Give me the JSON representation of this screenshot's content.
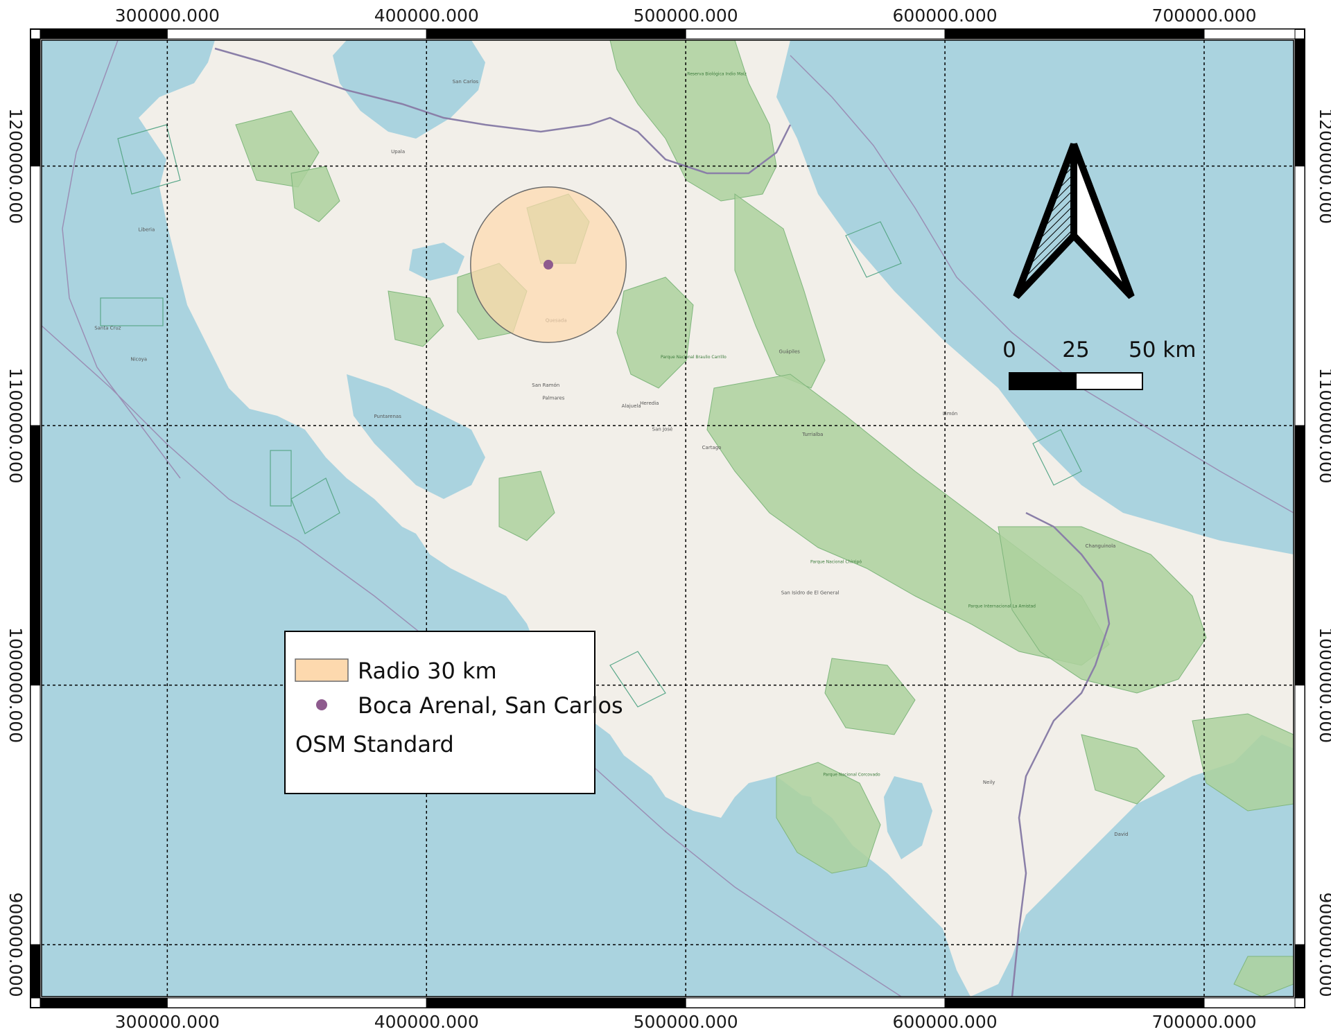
{
  "map": {
    "basemap": "OSM Standard",
    "colors": {
      "water": "#aad3df",
      "land": "#f2efe9",
      "forest": "#add19e",
      "park_border": "#7fb67c",
      "buffer_fill": "#fdd9ae",
      "buffer_stroke": "#6b6b6b",
      "point": "#8e5b8e",
      "border_line": "#9a8fb5"
    },
    "x_ticks": [
      {
        "value": 300000,
        "label": "300000.000"
      },
      {
        "value": 400000,
        "label": "400000.000"
      },
      {
        "value": 500000,
        "label": "500000.000"
      },
      {
        "value": 600000,
        "label": "600000.000"
      },
      {
        "value": 700000,
        "label": "700000.000"
      }
    ],
    "y_ticks": [
      {
        "value": 1200000,
        "label": "1200000.000"
      },
      {
        "value": 1100000,
        "label": "1100000.000"
      },
      {
        "value": 1000000,
        "label": "1000000.000"
      },
      {
        "value": 900000,
        "label": "900000.000"
      }
    ],
    "extent": {
      "xmin": 251500,
      "xmax": 734500,
      "ymin": 880000,
      "ymax": 1248500
    },
    "feature_point": {
      "name": "Boca Arenal, San Carlos",
      "x": 447000,
      "y": 1162000
    },
    "buffer_radius_m": 30000,
    "places": [
      {
        "name": "Liberia",
        "x": 292000,
        "y": 1175000
      },
      {
        "name": "Upala",
        "x": 389000,
        "y": 1205000
      },
      {
        "name": "San Carlos",
        "x": 415000,
        "y": 1232000
      },
      {
        "name": "Quesada",
        "x": 450000,
        "y": 1140000
      },
      {
        "name": "Nicoya",
        "x": 289000,
        "y": 1125000
      },
      {
        "name": "Santa Cruz",
        "x": 277000,
        "y": 1137000
      },
      {
        "name": "Puntarenas",
        "x": 385000,
        "y": 1103000
      },
      {
        "name": "San Ramón",
        "x": 446000,
        "y": 1115000
      },
      {
        "name": "Palmares",
        "x": 449000,
        "y": 1110000
      },
      {
        "name": "Alajuela",
        "x": 479000,
        "y": 1107000
      },
      {
        "name": "Heredia",
        "x": 486000,
        "y": 1108000
      },
      {
        "name": "San José",
        "x": 491000,
        "y": 1098000
      },
      {
        "name": "Cartago",
        "x": 510000,
        "y": 1091000
      },
      {
        "name": "Turrialba",
        "x": 549000,
        "y": 1096000
      },
      {
        "name": "Guápiles",
        "x": 540000,
        "y": 1128000
      },
      {
        "name": "Limón",
        "x": 602000,
        "y": 1104000
      },
      {
        "name": "Changuinola",
        "x": 660000,
        "y": 1053000
      },
      {
        "name": "San Isidro de El General",
        "x": 548000,
        "y": 1035000
      },
      {
        "name": "Neily",
        "x": 617000,
        "y": 962000
      },
      {
        "name": "David",
        "x": 668000,
        "y": 942000
      }
    ],
    "parks": [
      {
        "name": "Reserva Biológica Indio Maíz",
        "x": 512000,
        "y": 1235000
      },
      {
        "name": "Parque Nacional Chirripó",
        "x": 558000,
        "y": 1047000
      },
      {
        "name": "Parque Internacional La Amistad",
        "x": 622000,
        "y": 1030000
      },
      {
        "name": "Parque Nacional Corcovado",
        "x": 564000,
        "y": 965000
      },
      {
        "name": "Parque Nacional Braulio Carrillo",
        "x": 503000,
        "y": 1126000
      }
    ]
  },
  "legend": {
    "items": [
      {
        "label": "Radio 30 km",
        "kind": "polygon"
      },
      {
        "label": "Boca Arenal, San Carlos",
        "kind": "point"
      },
      {
        "label": "OSM Standard",
        "kind": "raster"
      }
    ]
  },
  "scale_bar": {
    "labels": [
      "0",
      "25",
      "50 km"
    ],
    "segments_km": [
      0,
      25,
      50
    ]
  },
  "north_arrow": {
    "icon": "north-arrow-icon"
  }
}
